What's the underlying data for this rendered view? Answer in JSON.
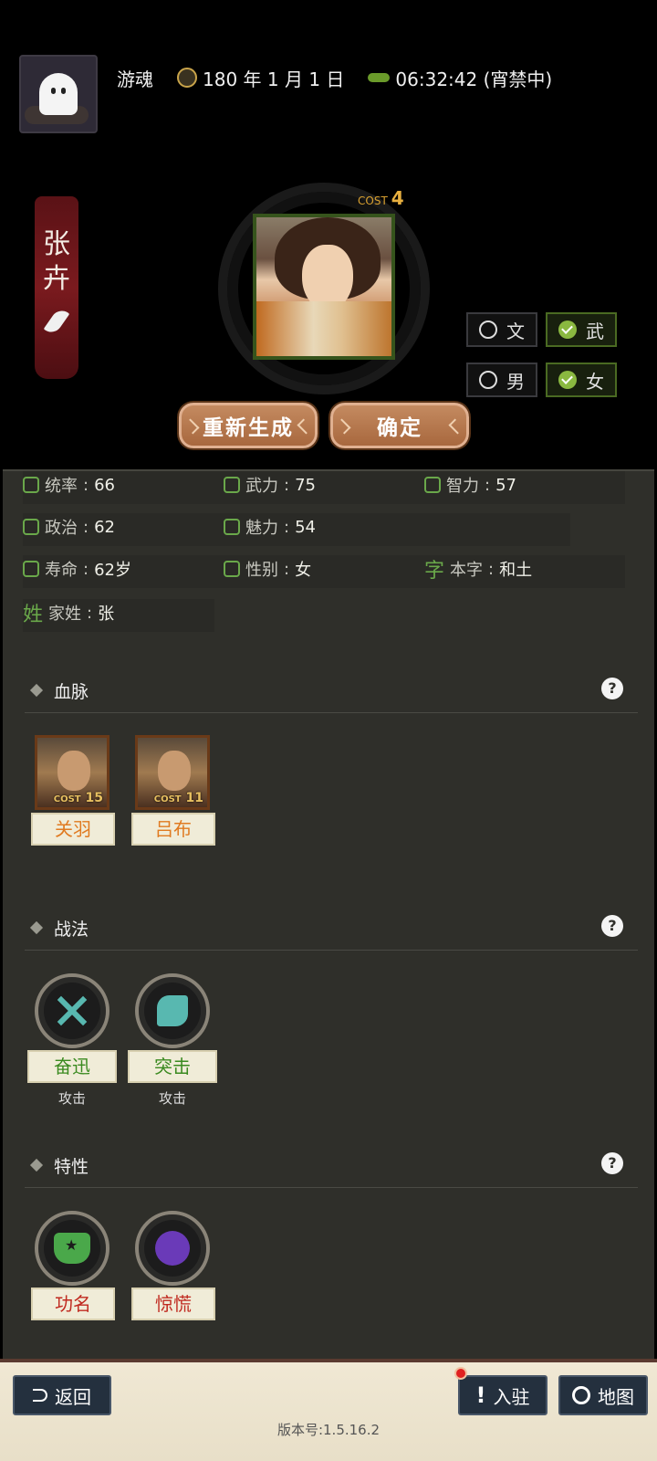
{
  "header": {
    "player_name": "游魂",
    "date": "180 年 1 月 1 日",
    "time": "06:32:42 (宵禁中)"
  },
  "character": {
    "name_chars": [
      "张",
      "卉"
    ],
    "cost_label": "COST",
    "cost_value": "4"
  },
  "toggles": {
    "wen": {
      "label": "文",
      "checked": false
    },
    "wu": {
      "label": "武",
      "checked": true
    },
    "male": {
      "label": "男",
      "checked": false
    },
    "female": {
      "label": "女",
      "checked": true
    }
  },
  "actions": {
    "regenerate": "重新生成",
    "confirm": "确定"
  },
  "stats": [
    {
      "label": "统率",
      "value": "66"
    },
    {
      "label": "武力",
      "value": "75"
    },
    {
      "label": "智力",
      "value": "57"
    },
    {
      "label": "政治",
      "value": "62"
    },
    {
      "label": "魅力",
      "value": "54"
    },
    {
      "label": "寿命",
      "value": "62岁"
    },
    {
      "label": "性别",
      "value": "女"
    },
    {
      "label": "本字",
      "value": "和土",
      "icon_char": "字"
    },
    {
      "label": "家姓",
      "value": "张",
      "icon_char": "姓"
    }
  ],
  "bloodline": {
    "title": "血脉",
    "heroes": [
      {
        "name": "关羽",
        "cost_label": "COST",
        "cost": "15"
      },
      {
        "name": "吕布",
        "cost_label": "COST",
        "cost": "11"
      }
    ]
  },
  "tactics": {
    "title": "战法",
    "items": [
      {
        "name": "奋迅",
        "type": "攻击",
        "icon": "crossed-swords-icon"
      },
      {
        "name": "突击",
        "type": "攻击",
        "icon": "runner-icon"
      }
    ]
  },
  "traits": {
    "title": "特性",
    "items": [
      {
        "name": "功名",
        "icon": "badge-icon"
      },
      {
        "name": "惊慌",
        "icon": "koala-icon"
      }
    ]
  },
  "bottom": {
    "back": "返回",
    "station": "入驻",
    "map": "地图",
    "version": "版本号:1.5.16.2"
  },
  "help_glyph": "?"
}
